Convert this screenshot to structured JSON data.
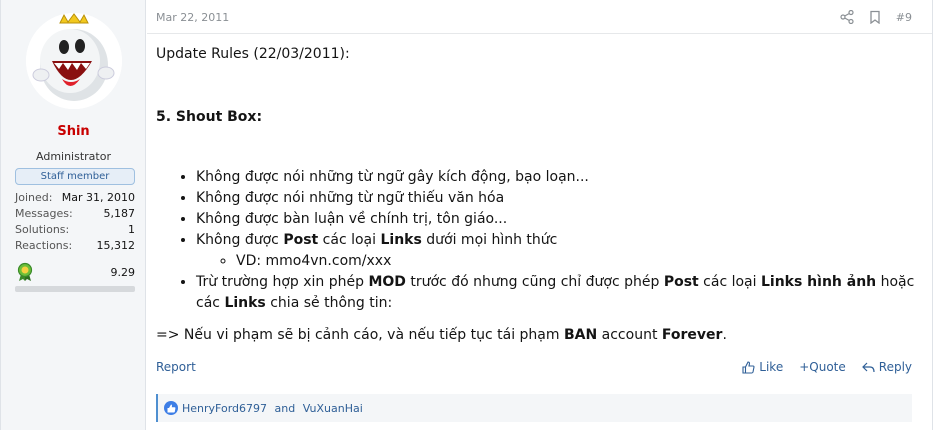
{
  "user": {
    "name": "Shin",
    "title": "Administrator",
    "badge": "Staff member",
    "stats": [
      {
        "label": "Joined:",
        "value": "Mar 31, 2010"
      },
      {
        "label": "Messages:",
        "value": "5,187"
      },
      {
        "label": "Solutions:",
        "value": "1"
      },
      {
        "label": "Reactions:",
        "value": "15,312"
      }
    ],
    "trophy_points": "9.29",
    "trophy_icon": "award-ribbon-icon",
    "progress_fraction": 0.0
  },
  "post": {
    "date": "Mar 22, 2011",
    "number": "#9",
    "line1": "Update Rules (22/03/2011):",
    "heading": "5. Shout Box:",
    "bullets": {
      "b1": "Không được nói những từ ngữ gây kích động, bạo loạn...",
      "b2": "Không được nói những từ ngữ thiếu văn hóa",
      "b3": "Không được bàn luận về chính trị, tôn giáo...",
      "b4_a": "Không được ",
      "b4_b": "Post",
      "b4_c": " các loại ",
      "b4_d": "Links",
      "b4_e": " dưới mọi hình thức",
      "sub": "VD: mmo4vn.com/xxx",
      "b5_a": "Trừ trường hợp xin phép ",
      "b5_b": "MOD",
      "b5_c": " trước đó nhưng cũng chỉ được phép ",
      "b5_d": "Post",
      "b5_e": " các loại ",
      "b5_f": "Links hình ảnh",
      "b5_g": " hoặc các ",
      "b5_h": "Links",
      "b5_i": " chia sẻ thông tin:"
    },
    "footer": {
      "a": "=> Nếu vi phạm sẽ bị cảnh cáo, và nếu tiếp tục tái phạm ",
      "b": "BAN",
      "c": " account ",
      "d": "Forever",
      "e": "."
    }
  },
  "actions": {
    "report": "Report",
    "like": "Like",
    "quote": "+Quote",
    "reply": "Reply"
  },
  "reactions": {
    "user1": "HenryFord6797",
    "and": " and ",
    "user2": "VuXuanHai"
  },
  "colors": {
    "accent": "#2f5f97",
    "username": "#c80000",
    "like": "#3d7ee6"
  }
}
